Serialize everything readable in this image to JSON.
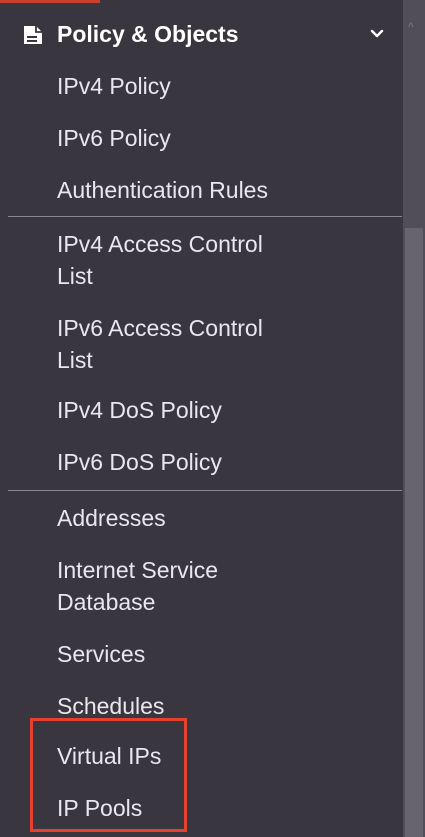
{
  "menu": {
    "section_title": "Policy & Objects",
    "section_icon": "document-icon",
    "expand_icon": "chevron-down-icon",
    "groups": [
      {
        "items": [
          {
            "label": "IPv4 Policy"
          },
          {
            "label": "IPv6 Policy"
          },
          {
            "label": "Authentication Rules"
          }
        ]
      },
      {
        "items": [
          {
            "label_line1": "IPv4 Access Control",
            "label_line2": "List"
          },
          {
            "label_line1": "IPv6 Access Control",
            "label_line2": "List"
          },
          {
            "label": "IPv4 DoS Policy"
          },
          {
            "label": "IPv6 DoS Policy"
          }
        ]
      },
      {
        "items": [
          {
            "label": "Addresses"
          },
          {
            "label_line1": "Internet Service",
            "label_line2": "Database"
          },
          {
            "label": "Services"
          },
          {
            "label": "Schedules"
          },
          {
            "label": "Virtual IPs",
            "highlighted": true
          },
          {
            "label": "IP Pools",
            "highlighted": true
          }
        ]
      }
    ]
  },
  "colors": {
    "background": "#3a3640",
    "text": "#e9e7ee",
    "highlight_border": "#e5412e",
    "divider": "#8a8792"
  }
}
